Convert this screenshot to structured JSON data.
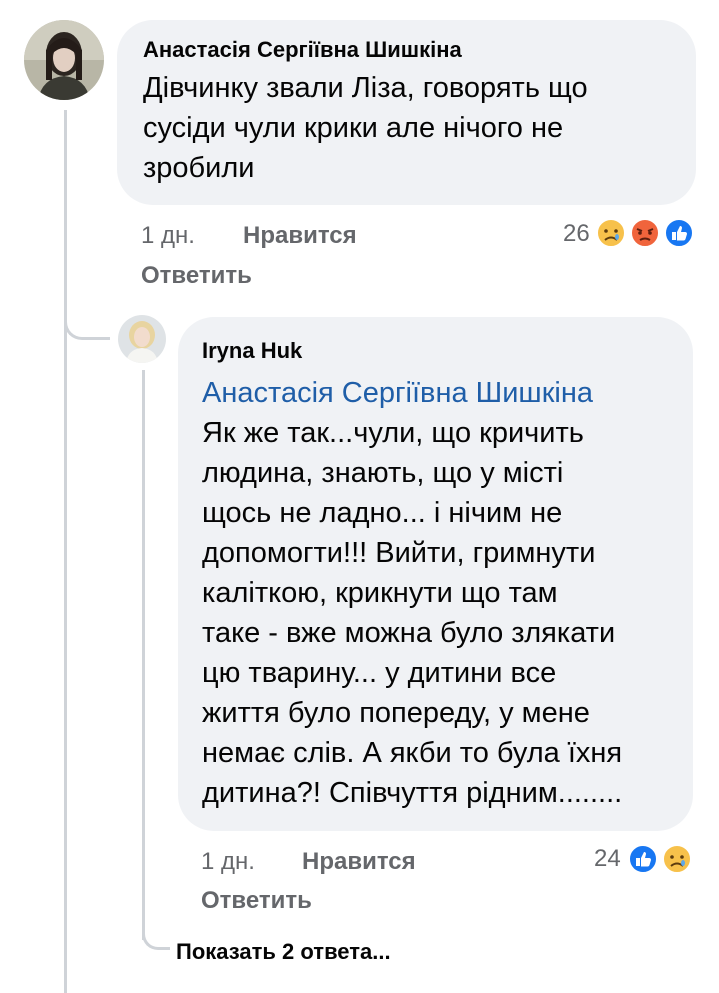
{
  "comments": [
    {
      "author": "Анастасія Сергіївна Шишкіна",
      "text": "Дівчинку звали Ліза, говорять що\nсусіди чули крики але нічого не\nзробили",
      "time": "1 дн.",
      "like_label": "Нравится",
      "reply_label": "Ответить",
      "reaction_count": "26",
      "reactions": [
        "sad-emoji",
        "angry-emoji",
        "like-emoji"
      ]
    },
    {
      "author": "Iryna Huk",
      "mention": "Анастасія Сергіївна Шишкіна",
      "text": "Як же так...чули, що кричить\nлюдина, знають, що у місті\nщось не ладно... і нічим не\nдопомогти!!! Вийти, гримнути\nкаліткою, крикнути що там\nтаке - вже можна було злякати\nцю тварину... у дитини все\nжиття було попереду, у мене\nнемає слів. А якби то була їхня\nдитина?! Співчуття рідним........",
      "time": "1 дн.",
      "like_label": "Нравится",
      "reply_label": "Ответить",
      "reaction_count": "24",
      "reactions": [
        "like-emoji",
        "sad-emoji"
      ]
    }
  ],
  "show_replies_label": "Показать 2 ответа...",
  "colors": {
    "bubble": "#f0f2f5",
    "secondary_text": "#65676b",
    "mention": "#1f5ea8",
    "like_blue": "#1877f2",
    "angry": "#f0643c",
    "sad_yellow": "#f7c14b"
  }
}
